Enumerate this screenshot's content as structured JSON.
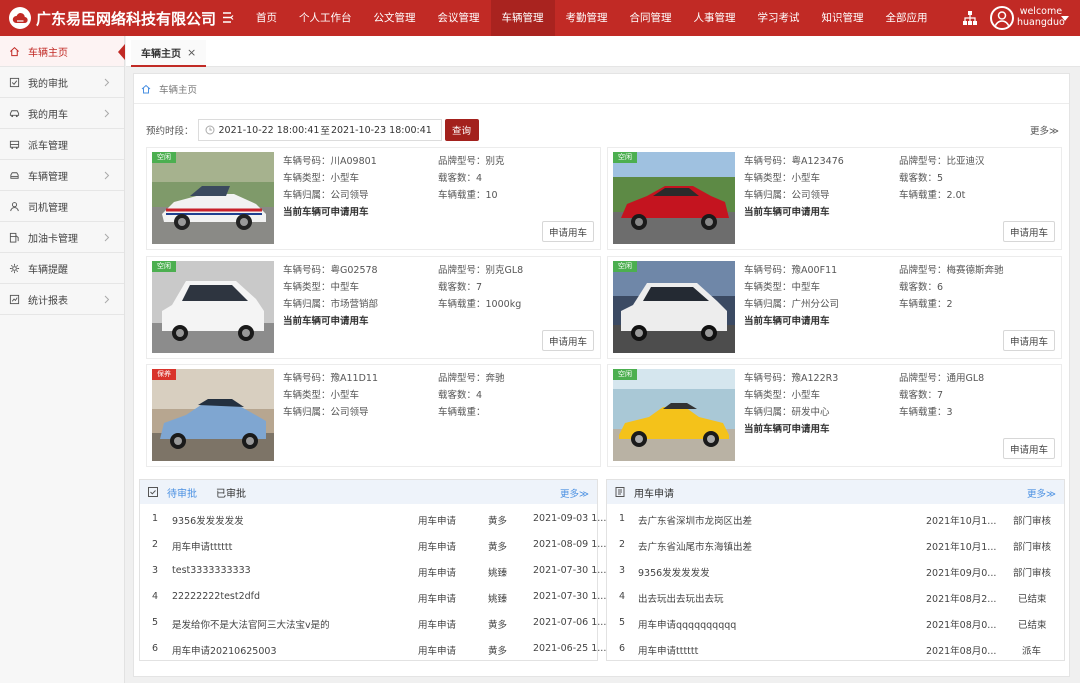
{
  "app": {
    "title": "广东易臣网络科技有限公司"
  },
  "topnav": [
    "首页",
    "个人工作台",
    "公文管理",
    "会议管理",
    "车辆管理",
    "考勤管理",
    "合同管理",
    "人事管理",
    "学习考试",
    "知识管理",
    "全部应用"
  ],
  "user": {
    "greeting": "welcome",
    "name": "huangduo"
  },
  "sidebar": [
    {
      "label": "车辆主页",
      "icon": "home-icon"
    },
    {
      "label": "我的审批",
      "icon": "check-square-icon"
    },
    {
      "label": "我的用车",
      "icon": "car-icon"
    },
    {
      "label": "派车管理",
      "icon": "bus-icon"
    },
    {
      "label": "车辆管理",
      "icon": "car-front-icon"
    },
    {
      "label": "司机管理",
      "icon": "person-icon"
    },
    {
      "label": "加油卡管理",
      "icon": "fuel-icon"
    },
    {
      "label": "车辆提醒",
      "icon": "gear-icon"
    },
    {
      "label": "统计报表",
      "icon": "chart-icon"
    }
  ],
  "tab": {
    "label": "车辆主页",
    "close": "×"
  },
  "breadcrumb": "车辆主页",
  "filter": {
    "label": "预约时段：",
    "start": "2021-10-22 18:00:41",
    "sep": "至",
    "end": "2021-10-23 18:00:41",
    "query": "查询"
  },
  "more": "更多≫",
  "labels": {
    "plate": "车辆号码：",
    "brand": "品牌型号：",
    "type": "车辆类型：",
    "seats": "载客数：",
    "owner": "车辆归属：",
    "load": "车辆载重：",
    "apply": "申请用车"
  },
  "cars": [
    {
      "status": "空闲",
      "status_color": "#4caf50",
      "plate": "川A09801",
      "brand": "别克",
      "type": "小型车",
      "seats": "4",
      "owner": "公司领导",
      "load": "10",
      "avail": "当前车辆可申请用车"
    },
    {
      "status": "空闲",
      "status_color": "#4caf50",
      "plate": "粤A123476",
      "brand": "比亚迪汉",
      "type": "小型车",
      "seats": "5",
      "owner": "公司领导",
      "load": "2.0t",
      "avail": "当前车辆可申请用车"
    },
    {
      "status": "空闲",
      "status_color": "#4caf50",
      "plate": "粤G02578",
      "brand": "别克GL8",
      "type": "中型车",
      "seats": "7",
      "owner": "市场营销部",
      "load": "1000kg",
      "avail": "当前车辆可申请用车"
    },
    {
      "status": "空闲",
      "status_color": "#4caf50",
      "plate": "豫A00F11",
      "brand": "梅赛德斯奔驰",
      "type": "中型车",
      "seats": "6",
      "owner": "广州分公司",
      "load": "2",
      "avail": "当前车辆可申请用车"
    },
    {
      "status": "保养",
      "status_color": "#d9342b",
      "plate": "豫A11D11",
      "brand": "奔驰",
      "type": "小型车",
      "seats": "4",
      "owner": "公司领导",
      "load": "",
      "avail": ""
    },
    {
      "status": "空闲",
      "status_color": "#4caf50",
      "plate": "豫A122R3",
      "brand": "通用GL8",
      "type": "小型车",
      "seats": "7",
      "owner": "研发中心",
      "load": "3",
      "avail": "当前车辆可申请用车"
    }
  ],
  "approval": {
    "tab_pending": "待审批",
    "tab_done": "已审批",
    "more": "更多≫",
    "rows": [
      {
        "no": "1",
        "title": "9356发发发发发",
        "kind": "用车申请",
        "user": "黄多",
        "date": "2021-09-03 1..."
      },
      {
        "no": "2",
        "title": "用车申请tttttt",
        "kind": "用车申请",
        "user": "黄多",
        "date": "2021-08-09 1..."
      },
      {
        "no": "3",
        "title": "test3333333333",
        "kind": "用车申请",
        "user": "姚臻",
        "date": "2021-07-30 1..."
      },
      {
        "no": "4",
        "title": "22222222test2dfd",
        "kind": "用车申请",
        "user": "姚臻",
        "date": "2021-07-30 1..."
      },
      {
        "no": "5",
        "title": "是发给你不是大法官阿三大法宝v是的",
        "kind": "用车申请",
        "user": "黄多",
        "date": "2021-07-06 1..."
      },
      {
        "no": "6",
        "title": "用车申请20210625003",
        "kind": "用车申请",
        "user": "黄多",
        "date": "2021-06-25 1..."
      }
    ]
  },
  "usage": {
    "title": "用车申请",
    "more": "更多≫",
    "rows": [
      {
        "no": "1",
        "title": "去广东省深圳市龙岗区出差",
        "date": "2021年10月1...",
        "status": "部门审核"
      },
      {
        "no": "2",
        "title": "去广东省汕尾市东海镇出差",
        "date": "2021年10月1...",
        "status": "部门审核"
      },
      {
        "no": "3",
        "title": "9356发发发发发",
        "date": "2021年09月0...",
        "status": "部门审核"
      },
      {
        "no": "4",
        "title": "出去玩出去玩出去玩",
        "date": "2021年08月2...",
        "status": "已结束"
      },
      {
        "no": "5",
        "title": "用车申请qqqqqqqqqq",
        "date": "2021年08月0...",
        "status": "已结束"
      },
      {
        "no": "6",
        "title": "用车申请tttttt",
        "date": "2021年08月0...",
        "status": "派车"
      }
    ]
  }
}
